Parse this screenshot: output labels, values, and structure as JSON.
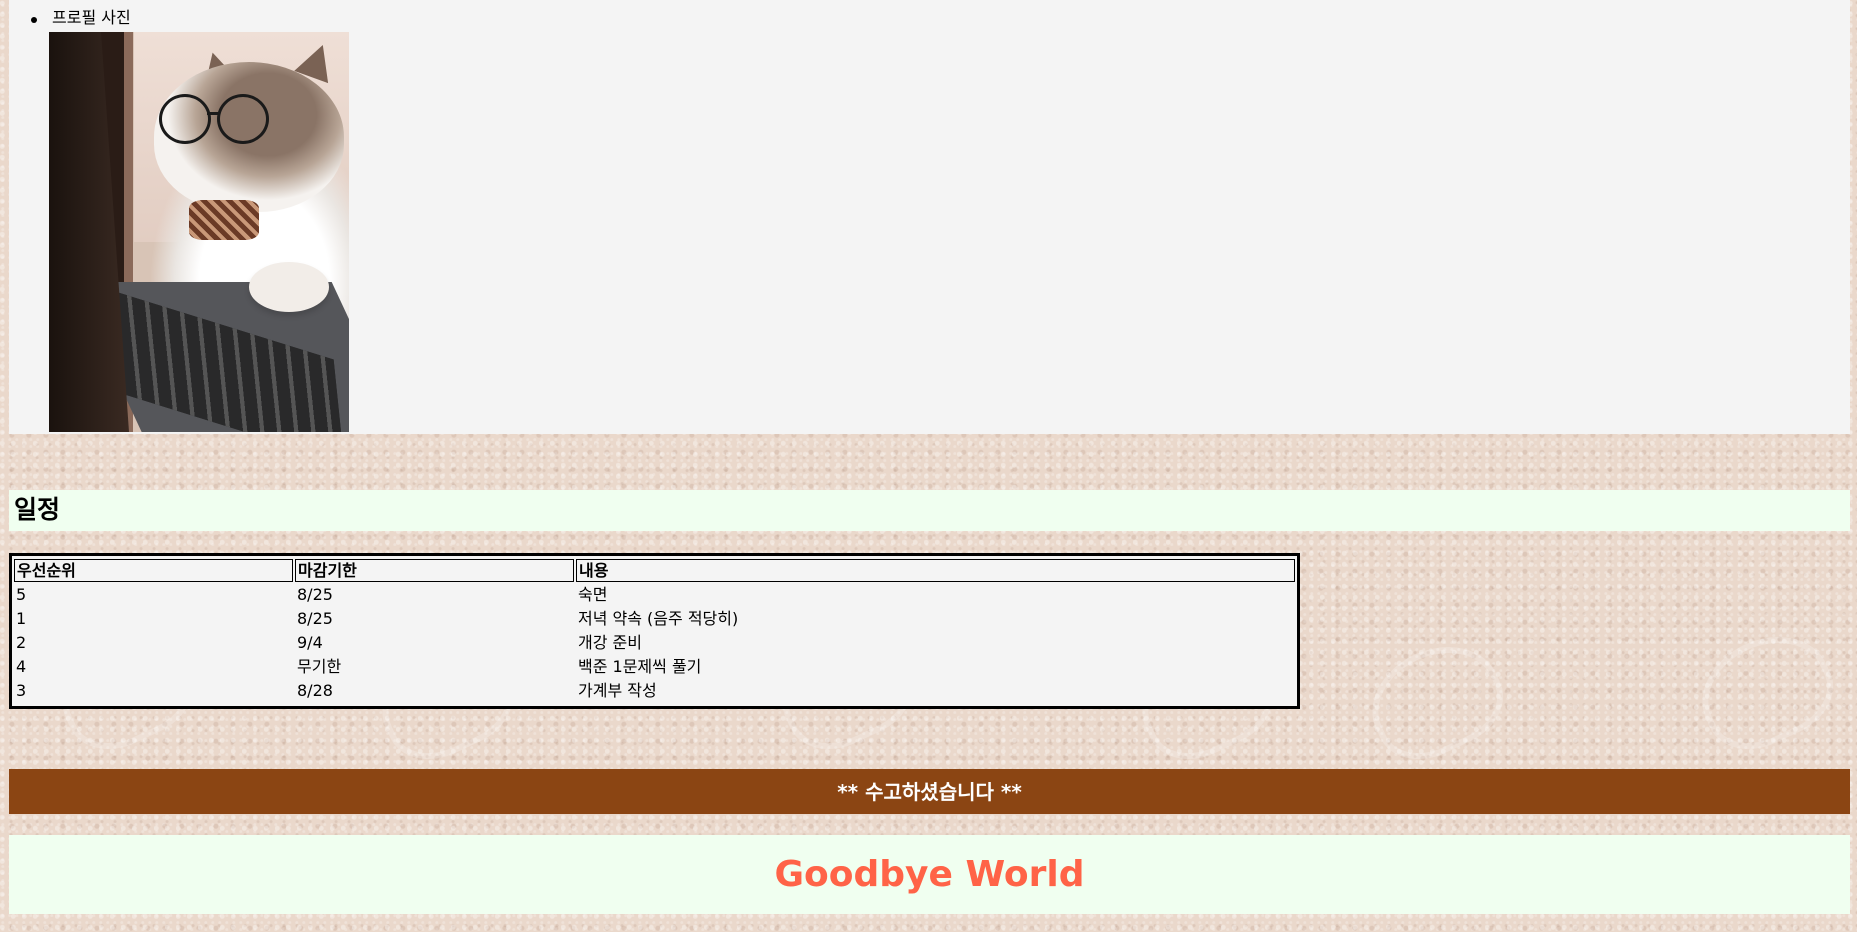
{
  "profile": {
    "label": "프로필 사진"
  },
  "schedule": {
    "heading": "일정",
    "columns": [
      "우선순위",
      "마감기한",
      "내용"
    ],
    "rows": [
      {
        "priority": "5",
        "deadline": "8/25",
        "content": "숙면"
      },
      {
        "priority": "1",
        "deadline": "8/25",
        "content": "저녁 약속 (음주 적당히)"
      },
      {
        "priority": "2",
        "deadline": "9/4",
        "content": "개강 준비"
      },
      {
        "priority": "4",
        "deadline": "무기한",
        "content": "백준 1문제씩 풀기"
      },
      {
        "priority": "3",
        "deadline": "8/28",
        "content": "가계부 작성"
      }
    ]
  },
  "footer": {
    "thanks": "** 수고하셨습니다 **",
    "goodbye": "Goodbye World"
  },
  "colors": {
    "profile_bg": "#f4f4f4",
    "heading_bg": "#f0fff0",
    "thanks_bg": "#8b4513",
    "goodbye_text": "#ff6347"
  }
}
